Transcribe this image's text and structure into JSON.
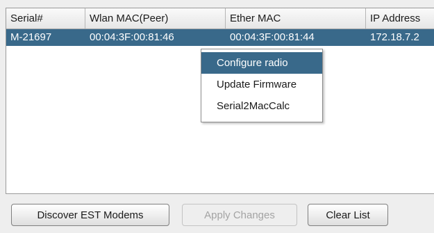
{
  "table": {
    "columns": [
      "Serial#",
      "Wlan MAC(Peer)",
      "Ether MAC",
      "IP Address"
    ],
    "rows": [
      {
        "serial": "M-21697",
        "wlan_mac": "00:04:3F:00:81:46",
        "ether_mac": "00:04:3F:00:81:44",
        "ip": "172.18.7.2"
      }
    ],
    "selection_color": "#39698a"
  },
  "context_menu": {
    "items": [
      "Configure radio",
      "Update Firmware",
      "Serial2MacCalc"
    ],
    "active_index": 0
  },
  "buttons": {
    "discover": "Discover EST Modems",
    "apply": "Apply Changes",
    "clear": "Clear List"
  }
}
